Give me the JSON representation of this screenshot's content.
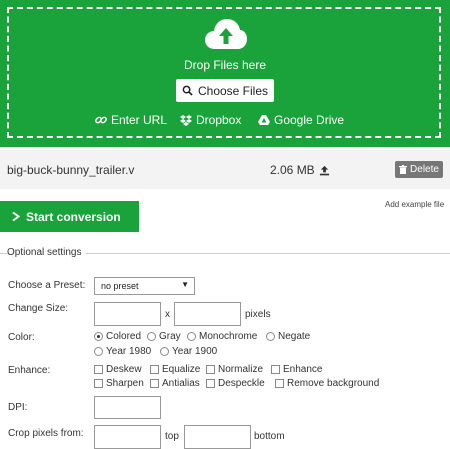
{
  "dropzone": {
    "text": "Drop Files here",
    "choose_files": "Choose Files",
    "enter_url": "Enter URL",
    "dropbox": "Dropbox",
    "google_drive": "Google Drive"
  },
  "file": {
    "name": "big-buck-bunny_trailer.v",
    "size": "2.06 MB",
    "delete_label": "Delete"
  },
  "actions": {
    "start": "Start conversion",
    "add_example": "Add example file"
  },
  "optional": {
    "title": "Optional settings",
    "preset_label": "Choose a Preset:",
    "preset_value": "no preset",
    "size_label": "Change Size:",
    "size_x": "x",
    "size_unit": "pixels",
    "color_label": "Color:",
    "color_options": [
      "Colored",
      "Gray",
      "Monochrome",
      "Negate",
      "Year 1980",
      "Year 1900"
    ],
    "color_selected": "Colored",
    "enhance_label": "Enhance:",
    "enhance_options": [
      "Deskew",
      "Equalize",
      "Normalize",
      "Enhance",
      "Sharpen",
      "Antialias",
      "Despeckle",
      "Remove background"
    ],
    "dpi_label": "DPI:",
    "crop_label": "Crop pixels from:",
    "crop_top": "top",
    "crop_bottom": "bottom"
  },
  "colors": {
    "accent": "#1aa33a",
    "delete_bg": "#777777"
  }
}
